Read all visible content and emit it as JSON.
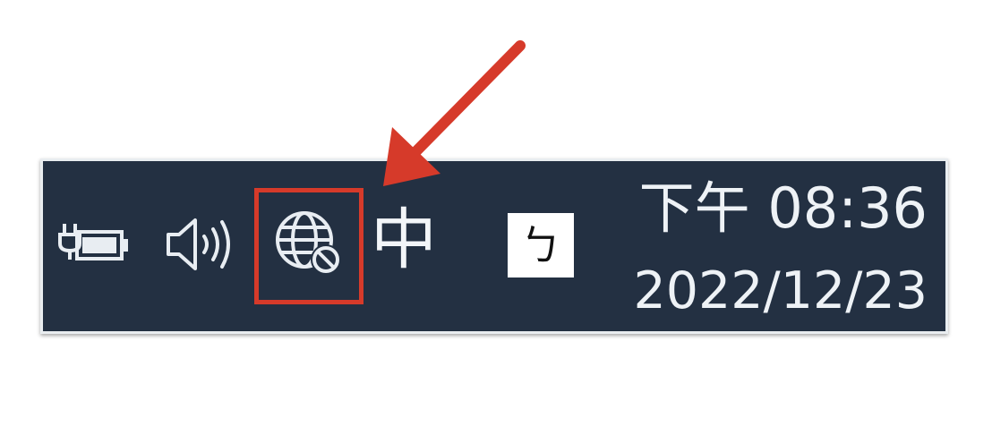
{
  "taskbar": {
    "tray_icons": {
      "battery": "battery-plugged-in-icon",
      "volume": "volume-speaker-icon",
      "network": "network-globe-no-internet-icon"
    },
    "ime_mode": "中",
    "ime_bopomofo": "ㄅ",
    "clock": {
      "time": "下午 08:36",
      "date": "2022/12/23"
    }
  },
  "annotation": {
    "highlight_target": "network-globe-no-internet-icon",
    "color": "#d63a2a"
  },
  "colors": {
    "taskbar_background": "#233042",
    "icon_foreground": "#e8edf2"
  }
}
